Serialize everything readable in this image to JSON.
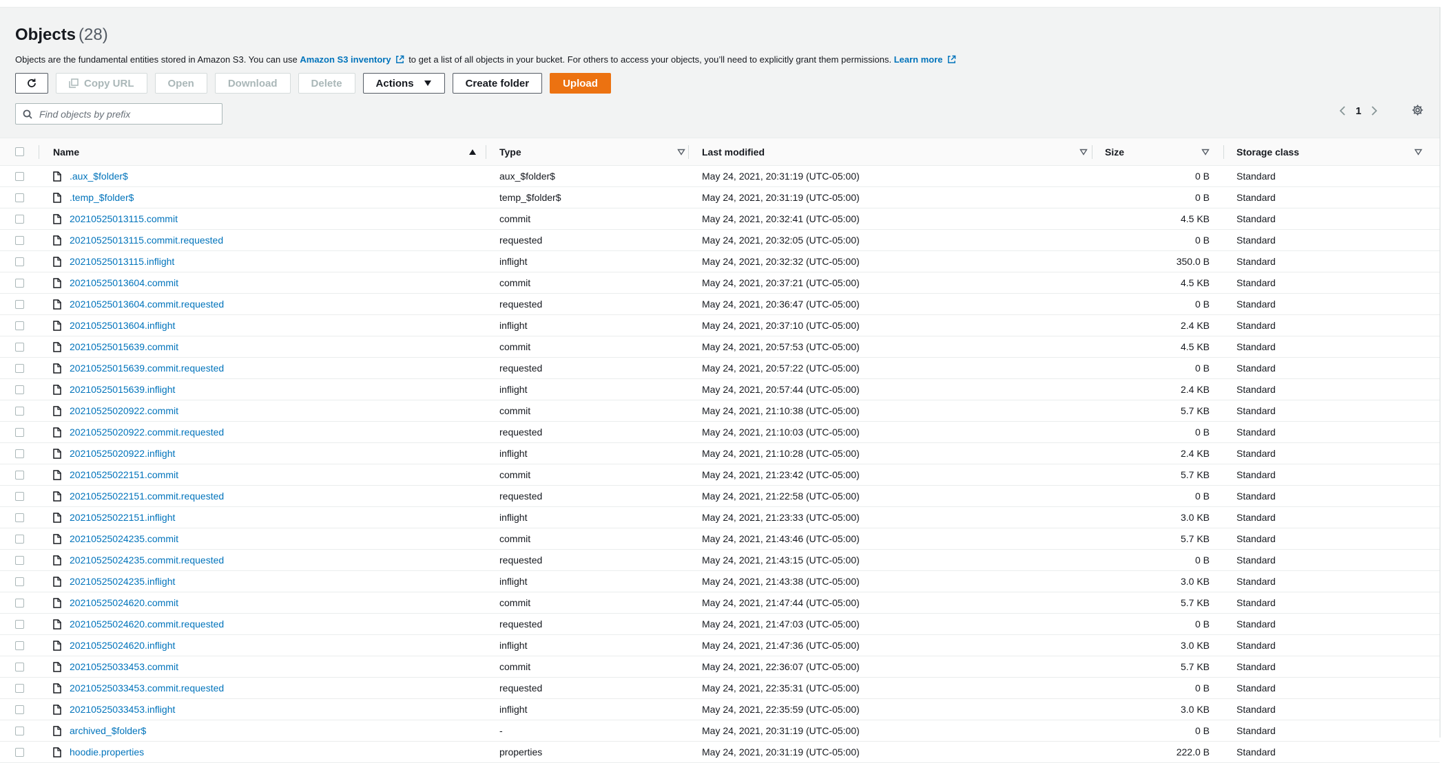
{
  "header": {
    "title": "Objects",
    "count": "(28)",
    "desc_prefix": "Objects are the fundamental entities stored in Amazon S3. You can use ",
    "inventory_link": "Amazon S3 inventory",
    "desc_middle": " to get a list of all objects in your bucket. For others to access your objects, you’ll need to explicitly grant them permissions. ",
    "learn_more": "Learn more"
  },
  "toolbar": {
    "copy_url": "Copy URL",
    "open": "Open",
    "download": "Download",
    "delete": "Delete",
    "actions": "Actions",
    "create_folder": "Create folder",
    "upload": "Upload"
  },
  "search": {
    "placeholder": "Find objects by prefix"
  },
  "pagination": {
    "page": "1"
  },
  "columns": {
    "name": "Name",
    "type": "Type",
    "last_modified": "Last modified",
    "size": "Size",
    "storage_class": "Storage class"
  },
  "rows": [
    {
      "name": ".aux_$folder$",
      "type": "aux_$folder$",
      "modified": "May 24, 2021, 20:31:19 (UTC-05:00)",
      "size": "0 B",
      "class": "Standard"
    },
    {
      "name": ".temp_$folder$",
      "type": "temp_$folder$",
      "modified": "May 24, 2021, 20:31:19 (UTC-05:00)",
      "size": "0 B",
      "class": "Standard"
    },
    {
      "name": "20210525013115.commit",
      "type": "commit",
      "modified": "May 24, 2021, 20:32:41 (UTC-05:00)",
      "size": "4.5 KB",
      "class": "Standard"
    },
    {
      "name": "20210525013115.commit.requested",
      "type": "requested",
      "modified": "May 24, 2021, 20:32:05 (UTC-05:00)",
      "size": "0 B",
      "class": "Standard"
    },
    {
      "name": "20210525013115.inflight",
      "type": "inflight",
      "modified": "May 24, 2021, 20:32:32 (UTC-05:00)",
      "size": "350.0 B",
      "class": "Standard"
    },
    {
      "name": "20210525013604.commit",
      "type": "commit",
      "modified": "May 24, 2021, 20:37:21 (UTC-05:00)",
      "size": "4.5 KB",
      "class": "Standard"
    },
    {
      "name": "20210525013604.commit.requested",
      "type": "requested",
      "modified": "May 24, 2021, 20:36:47 (UTC-05:00)",
      "size": "0 B",
      "class": "Standard"
    },
    {
      "name": "20210525013604.inflight",
      "type": "inflight",
      "modified": "May 24, 2021, 20:37:10 (UTC-05:00)",
      "size": "2.4 KB",
      "class": "Standard"
    },
    {
      "name": "20210525015639.commit",
      "type": "commit",
      "modified": "May 24, 2021, 20:57:53 (UTC-05:00)",
      "size": "4.5 KB",
      "class": "Standard"
    },
    {
      "name": "20210525015639.commit.requested",
      "type": "requested",
      "modified": "May 24, 2021, 20:57:22 (UTC-05:00)",
      "size": "0 B",
      "class": "Standard"
    },
    {
      "name": "20210525015639.inflight",
      "type": "inflight",
      "modified": "May 24, 2021, 20:57:44 (UTC-05:00)",
      "size": "2.4 KB",
      "class": "Standard"
    },
    {
      "name": "20210525020922.commit",
      "type": "commit",
      "modified": "May 24, 2021, 21:10:38 (UTC-05:00)",
      "size": "5.7 KB",
      "class": "Standard"
    },
    {
      "name": "20210525020922.commit.requested",
      "type": "requested",
      "modified": "May 24, 2021, 21:10:03 (UTC-05:00)",
      "size": "0 B",
      "class": "Standard"
    },
    {
      "name": "20210525020922.inflight",
      "type": "inflight",
      "modified": "May 24, 2021, 21:10:28 (UTC-05:00)",
      "size": "2.4 KB",
      "class": "Standard"
    },
    {
      "name": "20210525022151.commit",
      "type": "commit",
      "modified": "May 24, 2021, 21:23:42 (UTC-05:00)",
      "size": "5.7 KB",
      "class": "Standard"
    },
    {
      "name": "20210525022151.commit.requested",
      "type": "requested",
      "modified": "May 24, 2021, 21:22:58 (UTC-05:00)",
      "size": "0 B",
      "class": "Standard"
    },
    {
      "name": "20210525022151.inflight",
      "type": "inflight",
      "modified": "May 24, 2021, 21:23:33 (UTC-05:00)",
      "size": "3.0 KB",
      "class": "Standard"
    },
    {
      "name": "20210525024235.commit",
      "type": "commit",
      "modified": "May 24, 2021, 21:43:46 (UTC-05:00)",
      "size": "5.7 KB",
      "class": "Standard"
    },
    {
      "name": "20210525024235.commit.requested",
      "type": "requested",
      "modified": "May 24, 2021, 21:43:15 (UTC-05:00)",
      "size": "0 B",
      "class": "Standard"
    },
    {
      "name": "20210525024235.inflight",
      "type": "inflight",
      "modified": "May 24, 2021, 21:43:38 (UTC-05:00)",
      "size": "3.0 KB",
      "class": "Standard"
    },
    {
      "name": "20210525024620.commit",
      "type": "commit",
      "modified": "May 24, 2021, 21:47:44 (UTC-05:00)",
      "size": "5.7 KB",
      "class": "Standard"
    },
    {
      "name": "20210525024620.commit.requested",
      "type": "requested",
      "modified": "May 24, 2021, 21:47:03 (UTC-05:00)",
      "size": "0 B",
      "class": "Standard"
    },
    {
      "name": "20210525024620.inflight",
      "type": "inflight",
      "modified": "May 24, 2021, 21:47:36 (UTC-05:00)",
      "size": "3.0 KB",
      "class": "Standard"
    },
    {
      "name": "20210525033453.commit",
      "type": "commit",
      "modified": "May 24, 2021, 22:36:07 (UTC-05:00)",
      "size": "5.7 KB",
      "class": "Standard"
    },
    {
      "name": "20210525033453.commit.requested",
      "type": "requested",
      "modified": "May 24, 2021, 22:35:31 (UTC-05:00)",
      "size": "0 B",
      "class": "Standard"
    },
    {
      "name": "20210525033453.inflight",
      "type": "inflight",
      "modified": "May 24, 2021, 22:35:59 (UTC-05:00)",
      "size": "3.0 KB",
      "class": "Standard"
    },
    {
      "name": "archived_$folder$",
      "type": "-",
      "modified": "May 24, 2021, 20:31:19 (UTC-05:00)",
      "size": "0 B",
      "class": "Standard"
    },
    {
      "name": "hoodie.properties",
      "type": "properties",
      "modified": "May 24, 2021, 20:31:19 (UTC-05:00)",
      "size": "222.0 B",
      "class": "Standard"
    }
  ],
  "icons": {
    "refresh": "refresh-icon",
    "copy": "copy-icon",
    "caret": "caret-down-icon",
    "search": "search-icon",
    "external": "external-link-icon",
    "file": "file-icon",
    "sort": "sort-icon",
    "settings": "gear-icon"
  },
  "colors": {
    "link": "#0073bb",
    "primary": "#ec7211",
    "disabled_text": "#aab7b8"
  }
}
